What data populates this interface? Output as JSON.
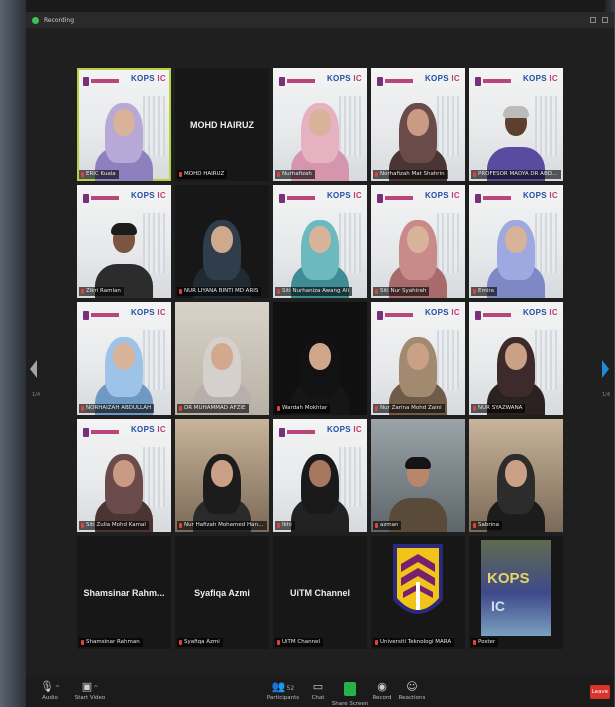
{
  "window": {
    "recording_label": "Recording"
  },
  "pagination": {
    "left_page": "1/4",
    "right_page": "1/4"
  },
  "branding": {
    "kops_text": "KOPS",
    "ic_text": "IC"
  },
  "gallery": [
    {
      "label": "ERIC Kuala",
      "center_name": "",
      "bg": "bg-white",
      "active": true,
      "avatar": {
        "hijab": "#b8a8d8",
        "body": "#8e7fbf",
        "skin": "#d8b39a"
      }
    },
    {
      "label": "MOHD HAIRUZ",
      "center_name": "MOHD HAIRUZ",
      "bg": "bg-dark",
      "active": false,
      "avatar": null
    },
    {
      "label": "Nurhafizah",
      "center_name": "",
      "bg": "bg-white",
      "active": false,
      "avatar": {
        "hijab": "#e6b2c2",
        "body": "#d596ad",
        "skin": "#d8b39a"
      }
    },
    {
      "label": "Norhafizah Mat Shahrin",
      "center_name": "",
      "bg": "bg-white",
      "active": false,
      "avatar": {
        "hijab": "#6b4b4a",
        "body": "#4b3434",
        "skin": "#c99b82"
      }
    },
    {
      "label": "PROFESOR MADYA DR ABDUL JALIL",
      "center_name": "",
      "bg": "bg-white",
      "active": false,
      "avatar": {
        "hijab": null,
        "hair": "#bbbbbb",
        "body": "#5a4aa0",
        "skin": "#5d3f2d"
      }
    },
    {
      "label": "Zikri Ramlan",
      "center_name": "",
      "bg": "bg-white",
      "active": false,
      "avatar": {
        "hijab": null,
        "hair": "#1b1b1b",
        "body": "#2c2c2c",
        "skin": "#7a5540"
      }
    },
    {
      "label": "NUR LIYANA BINTI MD ARIS",
      "center_name": "",
      "bg": "bg-dark",
      "active": false,
      "avatar": {
        "hijab": "#2f3e4a",
        "body": "#202a32",
        "skin": "#cfa98c"
      }
    },
    {
      "label": "Siti Nurhaniza Awang Ali",
      "center_name": "",
      "bg": "bg-white",
      "active": false,
      "avatar": {
        "hijab": "#6cbac0",
        "body": "#3f8d94",
        "skin": "#d8b39a"
      }
    },
    {
      "label": "Siti Nur Syahirah",
      "center_name": "",
      "bg": "bg-white",
      "active": false,
      "avatar": {
        "hijab": "#c98a8a",
        "body": "#a86b6b",
        "skin": "#d8b39a"
      }
    },
    {
      "label": "Emira",
      "center_name": "",
      "bg": "bg-white",
      "active": false,
      "avatar": {
        "hijab": "#9da9e0",
        "body": "#7d88c4",
        "skin": "#d8b39a"
      }
    },
    {
      "label": "NORHAIZAH ABDULLAH",
      "center_name": "",
      "bg": "bg-white",
      "active": false,
      "avatar": {
        "hijab": "#9dc4e8",
        "body": "#6d99c2",
        "skin": "#d8b39a"
      }
    },
    {
      "label": "DR MUHAMMAD AFZIE",
      "center_name": "",
      "bg": "bg-room",
      "active": false,
      "avatar": {
        "hijab": "#d6d0cc",
        "body": "#b8aeaa",
        "skin": "#d2a98e"
      }
    },
    {
      "label": "Wardah Mokhtar",
      "center_name": "",
      "bg": "bg-black",
      "active": false,
      "avatar": {
        "hijab": "#121212",
        "body": "#161616",
        "skin": "#d0a68c"
      }
    },
    {
      "label": "Nur Zarina Mohd Zaini",
      "center_name": "",
      "bg": "bg-white",
      "active": false,
      "avatar": {
        "hijab": "#a28a70",
        "body": "#6e5b48",
        "skin": "#caa086"
      }
    },
    {
      "label": "NUR SYAZWANA",
      "center_name": "",
      "bg": "bg-white",
      "active": false,
      "avatar": {
        "hijab": "#3d2b2b",
        "body": "#2c2121",
        "skin": "#caa086"
      }
    },
    {
      "label": "Siti Zulia Mohd Kamal",
      "center_name": "",
      "bg": "bg-white",
      "active": false,
      "avatar": {
        "hijab": "#6a4a4a",
        "body": "#4a3434",
        "skin": "#c99b82"
      }
    },
    {
      "label": "Nur Hafizah Mohamed Hanafi",
      "center_name": "",
      "bg": "bg-warm",
      "active": false,
      "avatar": {
        "hijab": "#1c1c1c",
        "body": "#2a2a2a",
        "skin": "#caa086"
      }
    },
    {
      "label": "Ikhi",
      "center_name": "",
      "bg": "bg-white",
      "active": false,
      "avatar": {
        "hijab": "#1a1a1a",
        "body": "#222222",
        "skin": "#a6785f"
      }
    },
    {
      "label": "azman",
      "center_name": "",
      "bg": "bg-office",
      "active": false,
      "avatar": {
        "hijab": null,
        "hair": "#151515",
        "body": "#5a4a3a",
        "skin": "#b8876b"
      }
    },
    {
      "label": "Sabrina",
      "center_name": "",
      "bg": "bg-warm",
      "active": false,
      "avatar": {
        "hijab": "#2c2c2c",
        "body": "#1c1c1c",
        "skin": "#caa086"
      }
    },
    {
      "label": "Shamsinar Rahman",
      "center_name": "Shamsinar Rahm...",
      "bg": "bg-dark",
      "active": false,
      "avatar": null
    },
    {
      "label": "Syafiqa Azmi",
      "center_name": "Syafiqa Azmi",
      "bg": "bg-dark",
      "active": false,
      "avatar": null
    },
    {
      "label": "UiTM Channel",
      "center_name": "UiTM Channel",
      "bg": "bg-dark",
      "active": false,
      "avatar": null
    },
    {
      "label": "Universiti Teknologi MARA",
      "center_name": "",
      "bg": "bg-dark",
      "active": false,
      "avatar": null,
      "special": "uitm-logo"
    },
    {
      "label": "Poster",
      "center_name": "",
      "bg": "bg-dark",
      "active": false,
      "avatar": null,
      "special": "kops-poster"
    }
  ],
  "toolbar": {
    "audio_label": "Audio",
    "video_label": "Start Video",
    "participants_label": "Participants",
    "participants_count": "52",
    "chat_label": "Chat",
    "share_label": "Share Screen",
    "record_label": "Record",
    "reactions_label": "Reactions",
    "leave_label": "Leave"
  },
  "colors": {
    "active_outline": "#b7d23a",
    "share_green": "#25b24a",
    "leave_red": "#d9342b",
    "mute_red": "#e0413c"
  }
}
